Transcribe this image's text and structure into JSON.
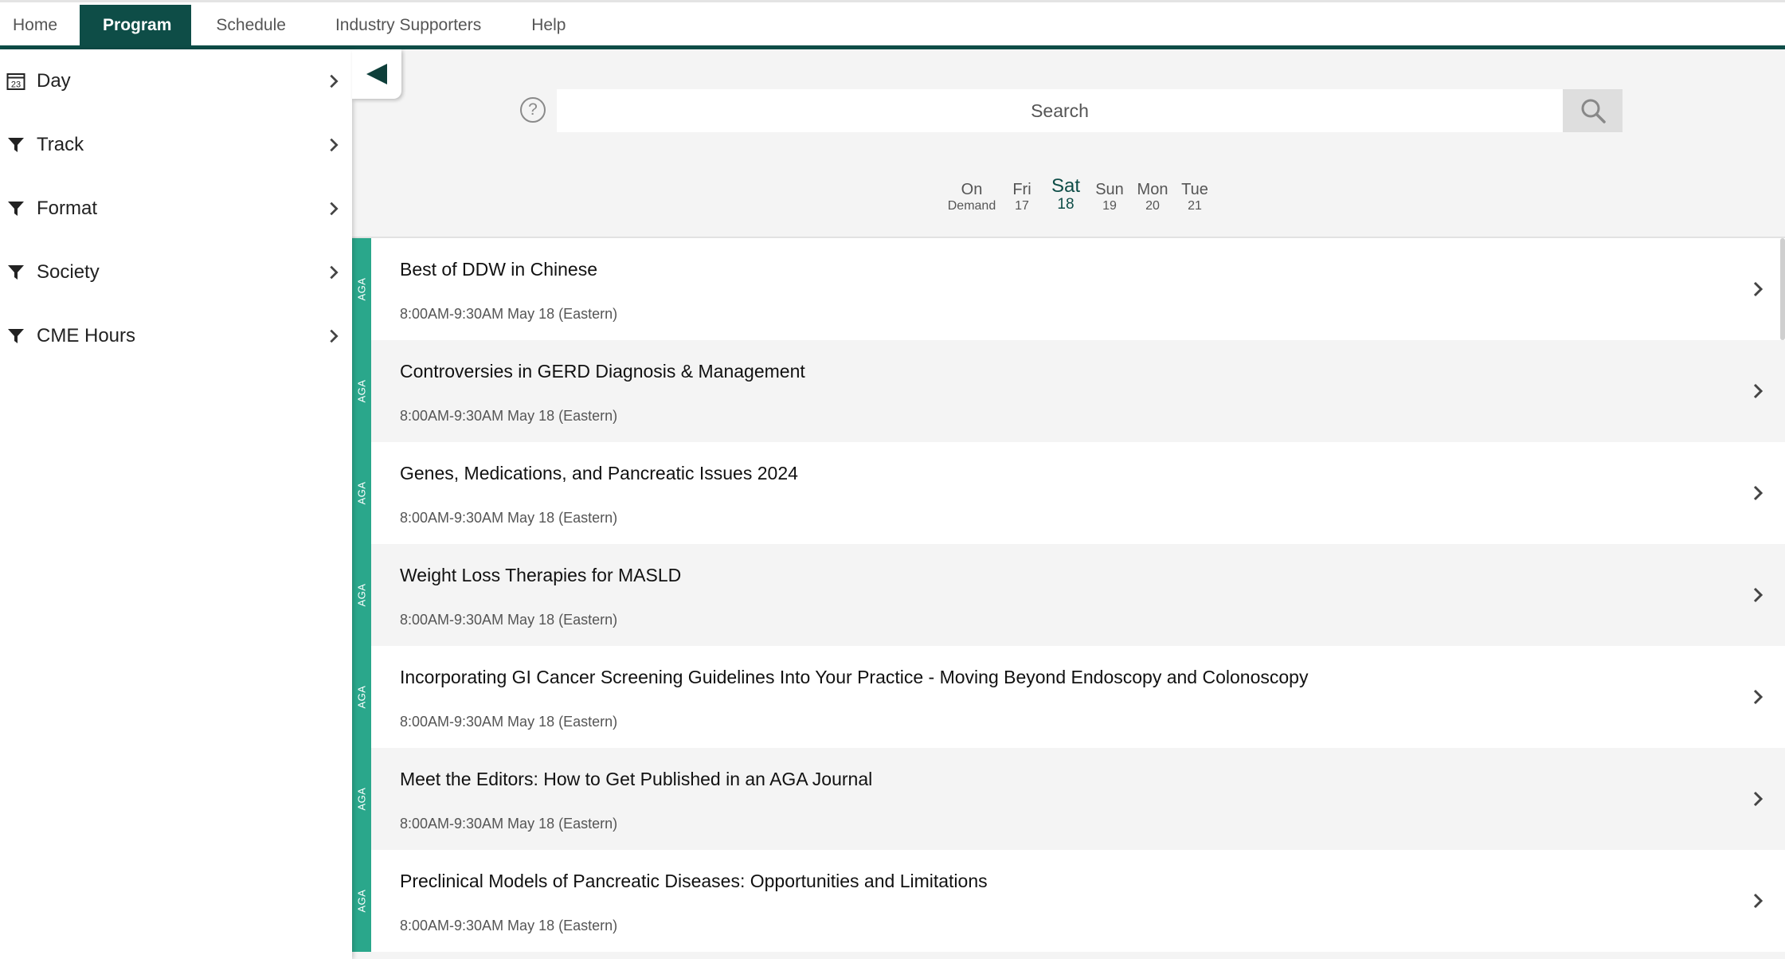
{
  "nav": {
    "tabs": [
      {
        "label": "Home",
        "active": false
      },
      {
        "label": "Program",
        "active": true
      },
      {
        "label": "Schedule",
        "active": false
      },
      {
        "label": "Industry Supporters",
        "active": false
      },
      {
        "label": "Help",
        "active": false
      }
    ],
    "accent_color": "#0e4d47"
  },
  "sidebar": {
    "items": [
      {
        "label": "Day",
        "icon": "calendar-icon",
        "icon_text": "23"
      },
      {
        "label": "Track",
        "icon": "filter-icon"
      },
      {
        "label": "Format",
        "icon": "filter-icon"
      },
      {
        "label": "Society",
        "icon": "filter-icon"
      },
      {
        "label": "CME Hours",
        "icon": "filter-icon"
      }
    ]
  },
  "search": {
    "placeholder": "Search",
    "help_glyph": "?"
  },
  "days": [
    {
      "name": "On",
      "date": "Demand",
      "selected": false
    },
    {
      "name": "Fri",
      "date": "17",
      "selected": false
    },
    {
      "name": "Sat",
      "date": "18",
      "selected": true
    },
    {
      "name": "Sun",
      "date": "19",
      "selected": false
    },
    {
      "name": "Mon",
      "date": "20",
      "selected": false
    },
    {
      "name": "Tue",
      "date": "21",
      "selected": false
    }
  ],
  "sessions": [
    {
      "society": "AGA",
      "title": "Best of DDW in Chinese",
      "time": "8:00AM-9:30AM May 18 (Eastern)"
    },
    {
      "society": "AGA",
      "title": "Controversies in GERD Diagnosis & Management",
      "time": "8:00AM-9:30AM May 18 (Eastern)"
    },
    {
      "society": "AGA",
      "title": "Genes, Medications, and Pancreatic Issues 2024",
      "time": "8:00AM-9:30AM May 18 (Eastern)"
    },
    {
      "society": "AGA",
      "title": "Weight Loss Therapies for MASLD",
      "time": "8:00AM-9:30AM May 18 (Eastern)"
    },
    {
      "society": "AGA",
      "title": "Incorporating GI Cancer Screening Guidelines Into Your Practice - Moving Beyond Endoscopy and Colonoscopy",
      "time": "8:00AM-9:30AM May 18 (Eastern)"
    },
    {
      "society": "AGA",
      "title": "Meet the Editors: How to Get Published in an AGA Journal",
      "time": "8:00AM-9:30AM May 18 (Eastern)"
    },
    {
      "society": "AGA",
      "title": "Preclinical Models of Pancreatic Diseases: Opportunities and Limitations",
      "time": "8:00AM-9:30AM May 18 (Eastern)"
    }
  ],
  "colors": {
    "stripe": "#2aa78b",
    "nav": "#0e4d47"
  }
}
